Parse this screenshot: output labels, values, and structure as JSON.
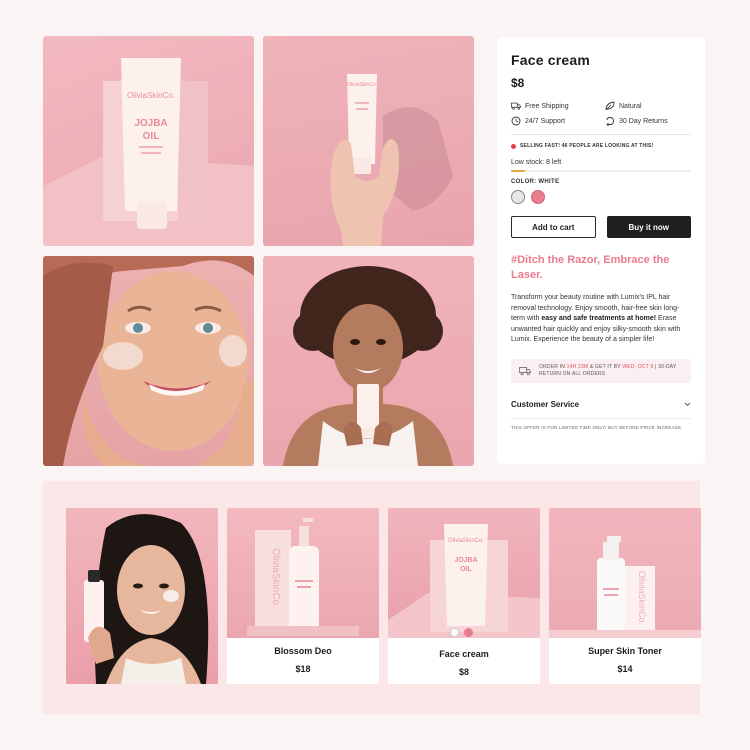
{
  "product": {
    "title": "Face cream",
    "price": "$8",
    "features": [
      {
        "icon": "truck-icon",
        "label": "Free Shipping"
      },
      {
        "icon": "leaf-icon",
        "label": "Natural"
      },
      {
        "icon": "support-icon",
        "label": "24/7 Support"
      },
      {
        "icon": "return-icon",
        "label": "30 Day Returns"
      }
    ],
    "selling_text": "SELLING FAST! 46 PEOPLE ARE LOOKING AT THIS!",
    "stock_text": "Low stock: 8 left",
    "stock_level_fraction": 0.08,
    "color_label": "COLOR: WHITE",
    "colors": [
      {
        "name": "white",
        "hex": "#e6e6e6",
        "selected": true
      },
      {
        "name": "pink",
        "hex": "#ea7d8d",
        "selected": false
      }
    ],
    "add_to_cart": "Add to cart",
    "buy_now": "Buy it now",
    "headline": "#Ditch the Razor, Embrace the Laser.",
    "desc_1": "Transform your beauty routine with Lumix's IPL hair removal technology. Enjoy smooth, hair-free skin long-term with ",
    "desc_bold": "easy and safe treatments at home!",
    "desc_2": " Erase unwanted hair quickly and enjoy silky-smooth skin with Lumix. Experience the beauty of a simpler life!",
    "delivery": {
      "p1": "ORDER IN ",
      "time": "14H 23M",
      "p2": " & GET IT BY ",
      "date": "WED, OCT 9",
      "p3": " | 30-DAY RETURN ON ALL ORDERS"
    },
    "customer_service": "Customer Service",
    "offer": "THIS OFFER IS FOR LIMITED TIME ONLY! BUY BEFORE PRICE INCREASE."
  },
  "gallery": {
    "brand": "OliviaSkinCo.",
    "product_line1": "JOJBA",
    "product_line2": "OIL"
  },
  "related": [
    {
      "name": "",
      "price": ""
    },
    {
      "name": "Blossom Deo",
      "price": "$18"
    },
    {
      "name": "Face cream",
      "price": "$8",
      "swatches": [
        "#ffffff",
        "#ea7d8d"
      ]
    },
    {
      "name": "Super Skin Toner",
      "price": "$14"
    }
  ],
  "colors": {
    "accent_pink": "#ec7b8b",
    "dark_button": "#1f1f21",
    "selling_dot": "#e5424d",
    "stock_bar": "#e8a83a"
  }
}
